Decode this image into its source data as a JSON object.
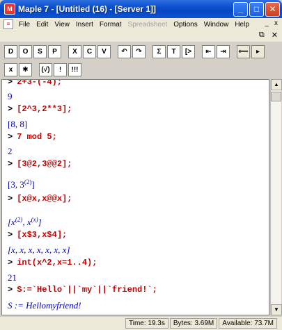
{
  "window": {
    "title": "Maple 7  - [Untitled (16) - [Server 1]]",
    "min": "_",
    "max": "□",
    "close": "✕"
  },
  "menu": {
    "items": [
      {
        "label": "File",
        "enabled": true
      },
      {
        "label": "Edit",
        "enabled": true
      },
      {
        "label": "View",
        "enabled": true
      },
      {
        "label": "Insert",
        "enabled": true
      },
      {
        "label": "Format",
        "enabled": true
      },
      {
        "label": "Spreadsheet",
        "enabled": false
      },
      {
        "label": "Options",
        "enabled": true
      },
      {
        "label": "Window",
        "enabled": true
      },
      {
        "label": "Help",
        "enabled": true
      }
    ],
    "doc_min": "_",
    "doc_close": "x",
    "doc_restore": "⧉",
    "doc_close2": "✕"
  },
  "toolbar1": [
    "D",
    "O",
    "S",
    "P",
    "X",
    "C",
    "V",
    "↶",
    "↷",
    "Σ",
    "T",
    "[>",
    "⇤",
    "⇥",
    "⟸",
    "▸"
  ],
  "toolbar2": [
    "x",
    "✱",
    "(√)",
    "!",
    "!!!"
  ],
  "worksheet": {
    "prompt": ">",
    "lines": [
      {
        "kind": "input",
        "text": "2+3-(-4);"
      },
      {
        "kind": "output",
        "text": "9"
      },
      {
        "kind": "input",
        "text": "[2^3,2**3];"
      },
      {
        "kind": "output",
        "text": "[8, 8]"
      },
      {
        "kind": "input",
        "text": "7 mod 5;"
      },
      {
        "kind": "output",
        "text": "2"
      },
      {
        "kind": "input",
        "text": "[3@2,3@@2];"
      },
      {
        "kind": "output_sup",
        "base": "[3, 3",
        "sup": "(2)",
        "tail": "]"
      },
      {
        "kind": "input",
        "text": "[x@x,x@@x];"
      },
      {
        "kind": "output_sup2",
        "p1": "[x",
        "s1": "(2)",
        "p2": ", x",
        "s2": "(x)",
        "p3": "]"
      },
      {
        "kind": "input",
        "text": "[x$3,x$4];"
      },
      {
        "kind": "output",
        "text": "[x, x, x, x, x, x, x]"
      },
      {
        "kind": "input",
        "text": "int(x^2,x=1..4);"
      },
      {
        "kind": "output",
        "text": "21"
      },
      {
        "kind": "input",
        "text": "S:=`Hello`||`my`||`friend!`;"
      },
      {
        "kind": "output",
        "text": "S := Hellomyfriend!"
      }
    ]
  },
  "status": {
    "time": "Time: 19.3s",
    "bytes": "Bytes: 3.69M",
    "available": "Available: 73.7M"
  }
}
